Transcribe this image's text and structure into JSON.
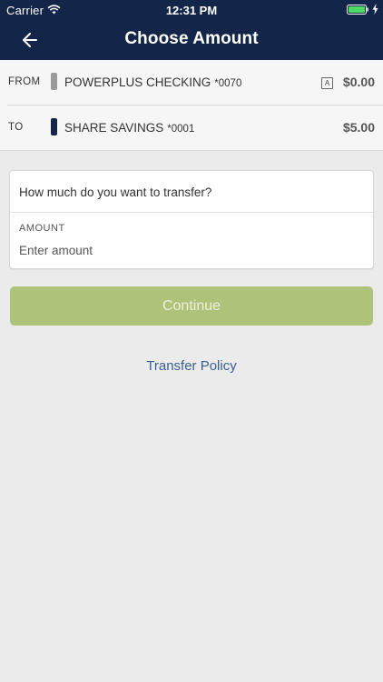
{
  "status_bar": {
    "carrier": "Carrier",
    "time": "12:31 PM",
    "wifi_icon": "wifi-icon",
    "battery_icon": "battery-icon",
    "charging_icon": "charging-bolt-icon",
    "battery_color": "#4cd964"
  },
  "header": {
    "title": "Choose Amount",
    "back_icon": "arrow-left-icon",
    "background_color": "#14254a"
  },
  "transfer": {
    "from": {
      "label": "FROM",
      "account_name": "POWERPLUS CHECKING",
      "account_number": "*0070",
      "badge": "A",
      "balance": "$0.00",
      "marker_color": "#9b9b9b"
    },
    "to": {
      "label": "TO",
      "account_name": "SHARE SAVINGS",
      "account_number": "*0001",
      "balance": "$5.00",
      "marker_color": "#14254a"
    }
  },
  "amount_card": {
    "question": "How much do you want to transfer?",
    "label": "AMOUNT",
    "placeholder": "Enter amount",
    "value": ""
  },
  "actions": {
    "continue_label": "Continue",
    "continue_color": "#afc27a",
    "transfer_policy_label": "Transfer Policy",
    "link_color": "#3a5f92"
  }
}
